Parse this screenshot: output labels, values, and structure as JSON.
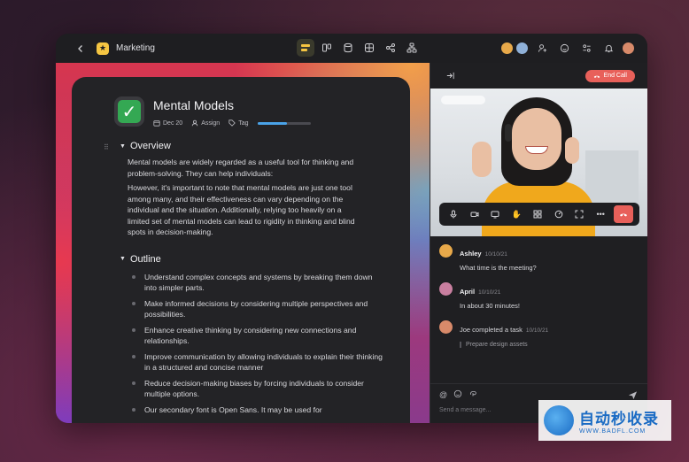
{
  "topbar": {
    "title": "Marketing",
    "back_icon": "chevron-left-icon",
    "center_icons": [
      "document-icon",
      "columns-icon",
      "database-icon",
      "grid-icon",
      "share-icon",
      "hierarchy-icon"
    ],
    "right_icons": [
      "add-user-icon",
      "emoji-icon",
      "settings-icon",
      "bell-icon"
    ]
  },
  "doc": {
    "title": "Mental Models",
    "date": "Dec 20",
    "assign": "Assign",
    "tag": "Tag",
    "progress": 0.55,
    "overview": {
      "heading": "Overview",
      "p1": "Mental models are widely regarded as a useful tool for thinking and problem-solving. They can help individuals:",
      "p2": "However, it's important to note that mental models are just one tool among many, and their effectiveness can vary depending on the individual and the situation. Additionally, relying too heavily on a limited set of mental models can lead to rigidity in thinking and blind spots in decision-making."
    },
    "outline": {
      "heading": "Outline",
      "items": [
        "Understand complex concepts and systems by breaking them down into simpler parts.",
        "Make informed decisions by considering multiple perspectives and possibilities.",
        "Enhance creative thinking by considering new connections and relationships.",
        "Improve communication by allowing individuals to explain their thinking in a structured and concise manner",
        "Reduce decision-making biases by forcing individuals to consider multiple options.",
        "Our secondary font is Open Sans. It may be used for"
      ]
    }
  },
  "call": {
    "end_call": "End Call"
  },
  "chat": {
    "messages": [
      {
        "name": "Ashley",
        "time": "10/10/21",
        "text": "What time is the meeting?",
        "color": "#e8a94a"
      },
      {
        "name": "April",
        "time": "10/10/21",
        "text": "In about 30 minutes!",
        "color": "#c97fa0"
      },
      {
        "name": "Joe completed a task",
        "time": "10/10/21",
        "text": "Prepare design assets",
        "color": "#d88a6a"
      }
    ],
    "placeholder": "Send a message..."
  },
  "watermark": {
    "big": "自动秒收录",
    "small": "WWW.BADFL.COM"
  }
}
